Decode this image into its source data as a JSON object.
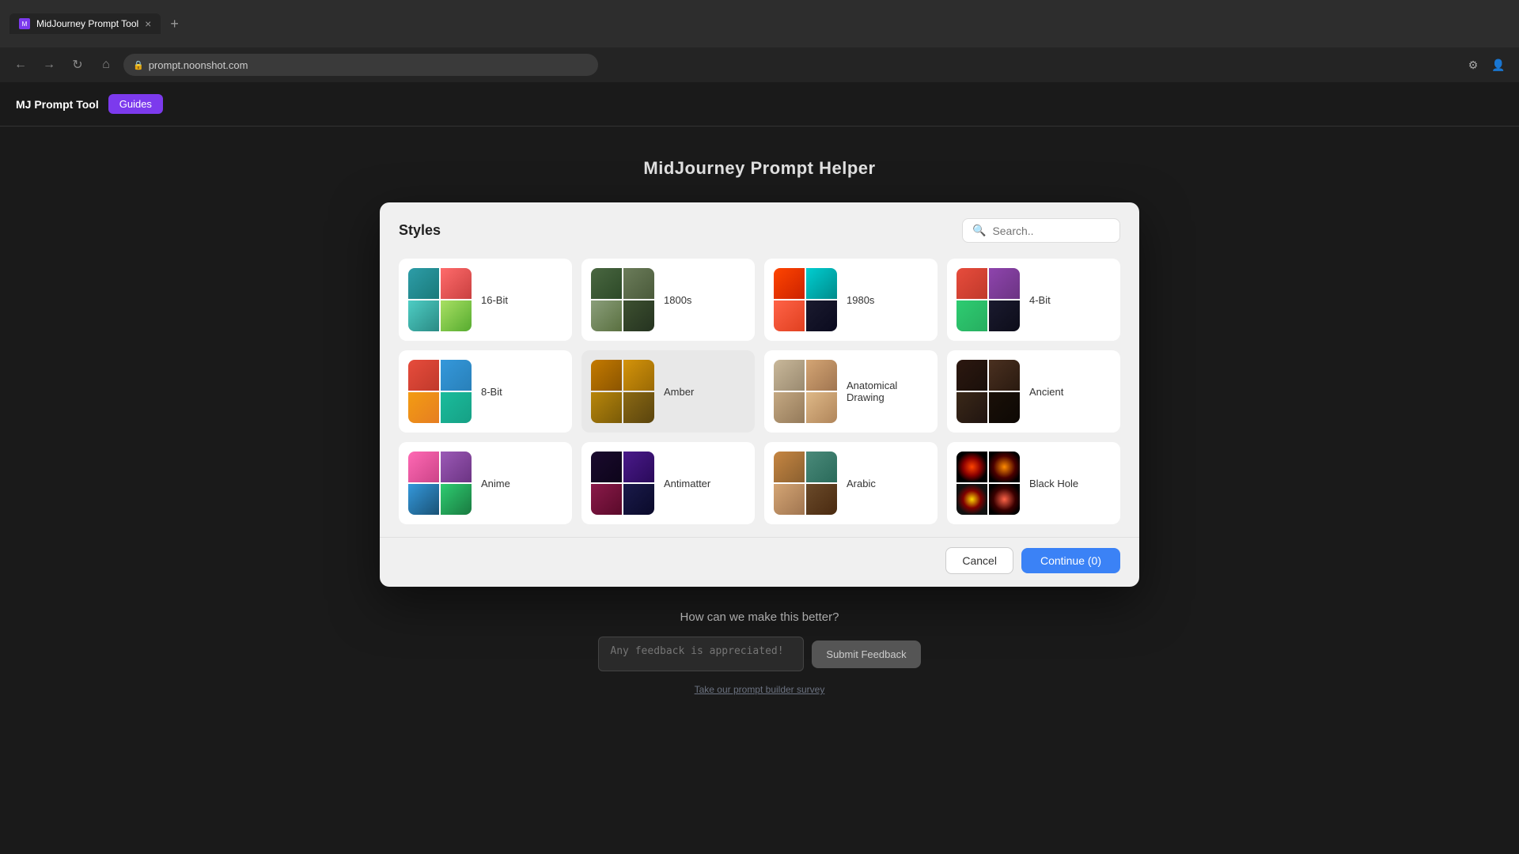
{
  "browser": {
    "tab_title": "MidJourney Prompt Tool",
    "tab_favicon": "M",
    "address": "prompt.noonshot.com",
    "new_tab_label": "+"
  },
  "app": {
    "logo": "MJ Prompt Tool",
    "guides_label": "Guides",
    "page_title": "MidJourney Prompt Helper"
  },
  "modal": {
    "title": "Styles",
    "search_placeholder": "Search..",
    "cancel_label": "Cancel",
    "continue_label": "Continue (0)",
    "styles": [
      {
        "id": "16bit",
        "label": "16-Bit",
        "thumb_class": "thumb-16bit"
      },
      {
        "id": "1800s",
        "label": "1800s",
        "thumb_class": "thumb-1800s"
      },
      {
        "id": "1980s",
        "label": "1980s",
        "thumb_class": "thumb-1980s"
      },
      {
        "id": "4bit",
        "label": "4-Bit",
        "thumb_class": "thumb-4bit"
      },
      {
        "id": "8bit",
        "label": "8-Bit",
        "thumb_class": "thumb-8bit"
      },
      {
        "id": "amber",
        "label": "Amber",
        "thumb_class": "thumb-amber",
        "hovered": true
      },
      {
        "id": "anatdraw",
        "label": "Anatomical Drawing",
        "thumb_class": "thumb-anatdraw"
      },
      {
        "id": "ancient",
        "label": "Ancient",
        "thumb_class": "thumb-ancient"
      },
      {
        "id": "anime",
        "label": "Anime",
        "thumb_class": "thumb-anime"
      },
      {
        "id": "antimatter",
        "label": "Antimatter",
        "thumb_class": "thumb-antimatter"
      },
      {
        "id": "arabic",
        "label": "Arabic",
        "thumb_class": "thumb-arabic"
      },
      {
        "id": "blackhole",
        "label": "Black Hole",
        "thumb_class": "thumb-blackhole"
      }
    ]
  },
  "feedback": {
    "title": "How can we make this better?",
    "input_placeholder": "Any feedback is appreciated!",
    "submit_label": "Submit Feedback",
    "update_link": "Take our prompt builder survey"
  }
}
